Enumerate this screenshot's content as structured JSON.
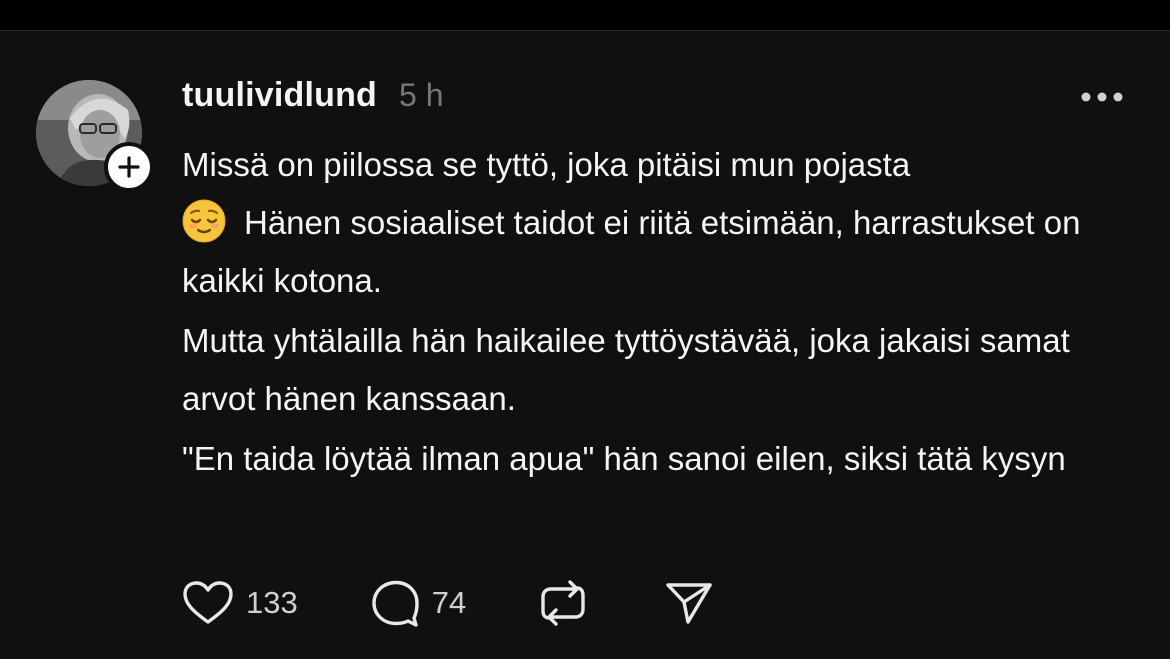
{
  "post": {
    "username": "tuulividlund",
    "timestamp": "5 h",
    "paragraphs": {
      "p1_line1": "Missä on piilossa se tyttö, joka pitäisi mun pojasta",
      "p1_rest": "Hänen sosiaaliset taidot ei riitä etsimään, harrastukset on kaikki kotona.",
      "p2": "Mutta yhtälailla hän haikailee tyttöystävää, joka jakaisi samat arvot hänen kanssaan.",
      "p3": "\"En taida löytää ilman apua\" hän sanoi eilen, siksi tätä kysyn"
    },
    "emoji": "relieved-face",
    "stats": {
      "likes": "133",
      "replies": "74"
    }
  },
  "icons": {
    "avatar": "avatar",
    "follow": "plus-icon",
    "more": "more-horizontal-icon",
    "like": "heart-icon",
    "reply": "speech-bubble-icon",
    "repost": "repost-icon",
    "share": "send-icon"
  },
  "colors": {
    "background": "#101010",
    "text": "#f3f5f7",
    "muted": "#777777"
  }
}
